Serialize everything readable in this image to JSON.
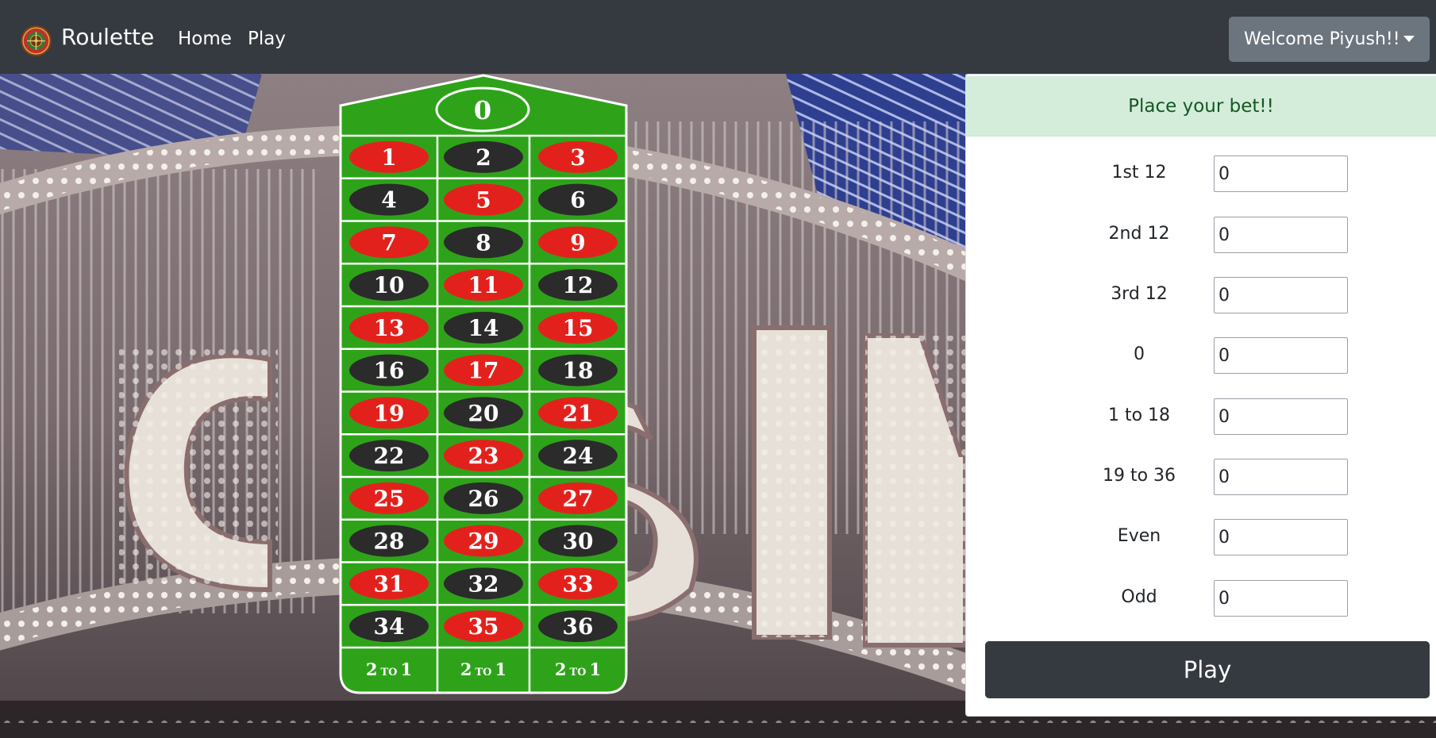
{
  "navbar": {
    "brand": "Roulette",
    "links": [
      {
        "label": "Home"
      },
      {
        "label": "Play"
      }
    ],
    "user_menu_label": "Welcome Piyush!!"
  },
  "table": {
    "zero": "0",
    "rows": [
      [
        "1",
        "2",
        "3"
      ],
      [
        "4",
        "5",
        "6"
      ],
      [
        "7",
        "8",
        "9"
      ],
      [
        "10",
        "11",
        "12"
      ],
      [
        "13",
        "14",
        "15"
      ],
      [
        "16",
        "17",
        "18"
      ],
      [
        "19",
        "20",
        "21"
      ],
      [
        "22",
        "23",
        "24"
      ],
      [
        "25",
        "26",
        "27"
      ],
      [
        "28",
        "29",
        "30"
      ],
      [
        "31",
        "32",
        "33"
      ],
      [
        "34",
        "35",
        "36"
      ]
    ],
    "red_numbers": [
      "1",
      "3",
      "5",
      "7",
      "9",
      "11",
      "13",
      "15",
      "17",
      "19",
      "21",
      "23",
      "25",
      "27",
      "29",
      "31",
      "33",
      "35"
    ],
    "column_bet_big": "2",
    "column_bet_small": "TO",
    "column_bet_end": "1",
    "colors": {
      "felt": "#2ea31a",
      "red": "#e3211c",
      "black": "#2b2b2b",
      "line": "#ffffff"
    }
  },
  "bet_panel": {
    "alert": "Place your bet!!",
    "bets": [
      {
        "label": "1st 12",
        "value": "0"
      },
      {
        "label": "2nd 12",
        "value": "0"
      },
      {
        "label": "3rd 12",
        "value": "0"
      },
      {
        "label": "0",
        "value": "0"
      },
      {
        "label": "1 to 18",
        "value": "0"
      },
      {
        "label": "19 to 36",
        "value": "0"
      },
      {
        "label": "Even",
        "value": "0"
      },
      {
        "label": "Odd",
        "value": "0"
      }
    ],
    "play_label": "Play"
  }
}
